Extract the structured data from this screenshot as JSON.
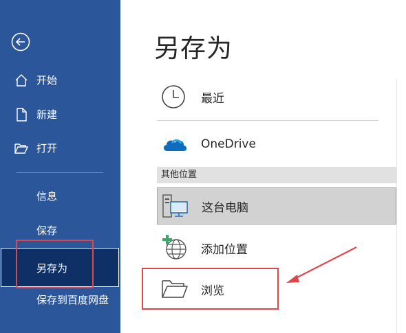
{
  "sidebar": {
    "items": [
      {
        "label": "开始"
      },
      {
        "label": "新建"
      },
      {
        "label": "打开"
      },
      {
        "label": "信息"
      },
      {
        "label": "保存"
      },
      {
        "label": "另存为"
      },
      {
        "label": "保存到百度网盘"
      }
    ],
    "selected": "另存为",
    "background": "#2b579a",
    "selected_background": "#0f2f67"
  },
  "main": {
    "title": "另存为",
    "locations": [
      {
        "label": "最近",
        "icon": "clock-icon"
      },
      {
        "label": "OneDrive",
        "icon": "cloud-icon"
      }
    ],
    "other_section": {
      "title": "其他位置",
      "items": [
        {
          "label": "这台电脑",
          "icon": "computer-icon",
          "selected": true
        },
        {
          "label": "添加位置",
          "icon": "add-globe-icon"
        },
        {
          "label": "浏览",
          "icon": "folder-icon"
        }
      ]
    }
  },
  "annotations": {
    "highlight_color": "#e0474a"
  }
}
